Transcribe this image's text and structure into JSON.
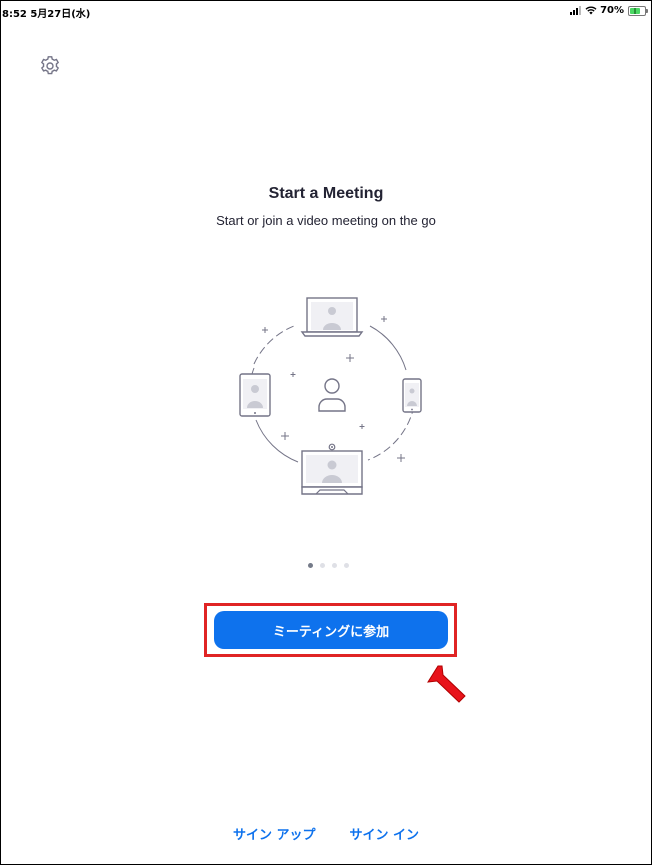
{
  "status_bar": {
    "time_date": "8:52  5月27日(水)",
    "battery_percent": "70%",
    "battery_level": 0.7
  },
  "settings_icon": "gear-icon",
  "onboarding": {
    "title": "Start a Meeting",
    "subtitle": "Start or join a video meeting on the go",
    "page_indicator": {
      "total": 4,
      "active_index": 0
    }
  },
  "join_button_label": "ミーティングに参加",
  "footer": {
    "sign_up_label": "サイン アップ",
    "sign_in_label": "サイン イン"
  },
  "colors": {
    "accent": "#0e72ed",
    "highlight": "#e02424",
    "text": "#232333"
  }
}
